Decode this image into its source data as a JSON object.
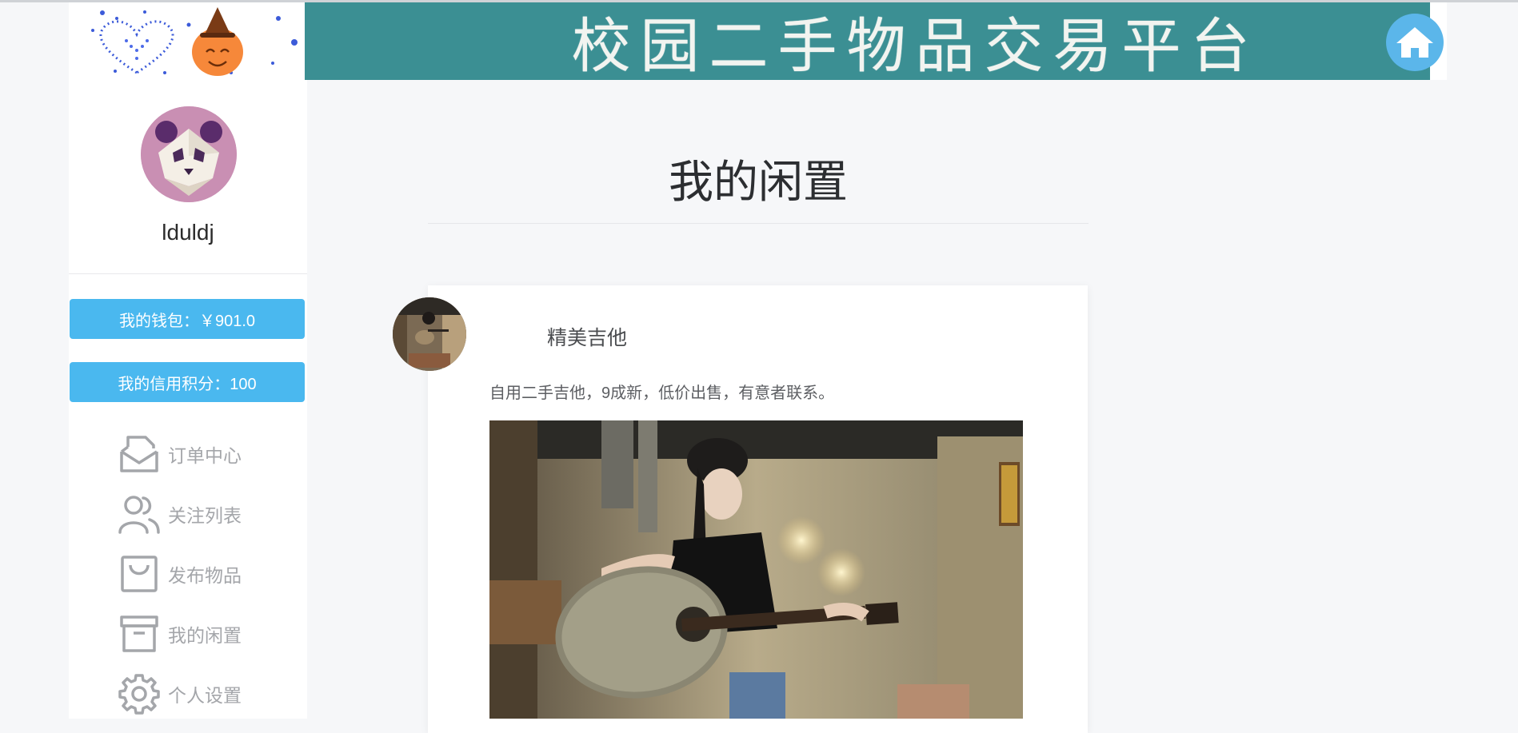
{
  "header": {
    "banner_title": "校园二手物品交易平台",
    "home_icon": "home-icon"
  },
  "sidebar": {
    "username": "lduldj",
    "wallet_label": "我的钱包：￥901.0",
    "credit_label": "我的信用积分：100",
    "menu": [
      {
        "label": "订单中心",
        "icon": "envelope-open-icon"
      },
      {
        "label": "关注列表",
        "icon": "users-icon"
      },
      {
        "label": "发布物品",
        "icon": "shopping-bag-icon"
      },
      {
        "label": "我的闲置",
        "icon": "archive-box-icon"
      },
      {
        "label": "个人设置",
        "icon": "gear-icon"
      }
    ]
  },
  "main": {
    "page_title": "我的闲置",
    "item": {
      "name": "精美吉他",
      "description": "自用二手吉他，9成新，低价出售，有意者联系。"
    }
  },
  "colors": {
    "banner": "#3b8f93",
    "accent": "#4ab8ef",
    "home_button": "#5bb6ea",
    "menu_text": "#a4a6aa"
  }
}
